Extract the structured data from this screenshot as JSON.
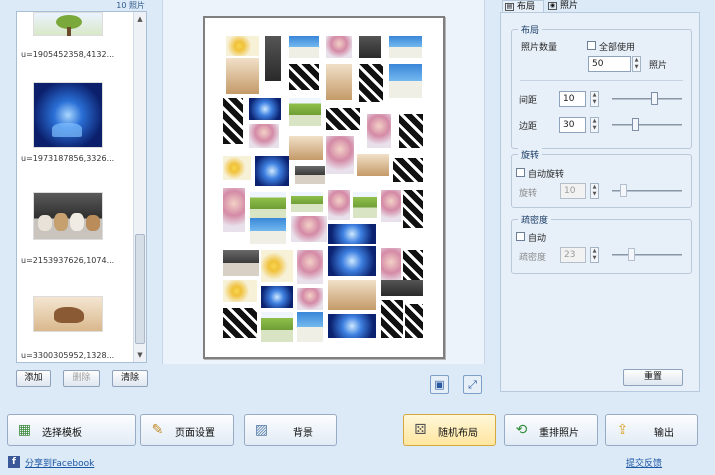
{
  "photo_list": {
    "count_label": "10 照片",
    "items": [
      {
        "caption": "u=1905452358,4132...",
        "thumb": "tree"
      },
      {
        "caption": "u=1973187856,3326...",
        "thumb": "blue-light"
      },
      {
        "caption": "u=2153937626,1074...",
        "thumb": "puppies"
      },
      {
        "caption": "u=3300305952,1328...",
        "thumb": "horse"
      }
    ],
    "add_label": "添加",
    "delete_label": "删除",
    "clear_label": "清除"
  },
  "tabs": {
    "layout": "布局",
    "photos": "照片"
  },
  "settings": {
    "layout_group": "布局",
    "photo_count_label": "照片数量",
    "use_all_label": "全部使用",
    "photo_count_value": "50",
    "photo_unit": "照片",
    "spacing_label": "间距",
    "spacing_value": "10",
    "margin_label": "边距",
    "margin_value": "30",
    "rotation_group": "旋转",
    "auto_rotate_label": "自动旋转",
    "rotate_label": "旋转",
    "rotate_value": "10",
    "density_group": "疏密度",
    "auto_label": "自动",
    "density_label": "疏密度",
    "density_value": "23",
    "reset_label": "重置"
  },
  "toolbar": {
    "select_template": "选择模板",
    "page_setup": "页面设置",
    "background": "背景",
    "random_layout": "随机布局",
    "rearrange_photos": "重排照片",
    "output": "输出"
  },
  "links": {
    "facebook_share": "分享到Facebook",
    "feedback": "提交反馈"
  },
  "colors": {
    "accent": "#dce9f6",
    "active_button": "#ffe6a0",
    "facebook": "#3b5998"
  }
}
